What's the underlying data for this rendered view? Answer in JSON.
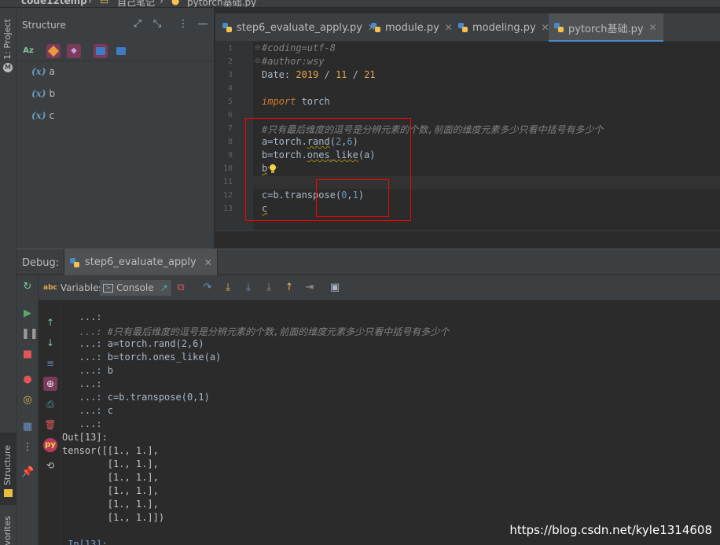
{
  "breadcrumb": {
    "project": "code12temp",
    "folder": "自己笔记",
    "file": "pytorch基础.py"
  },
  "left_strip": {
    "project_label": "1: Project",
    "structure_label": "Z: Structure",
    "favorites_label": "vorites"
  },
  "structure": {
    "title": "Structure",
    "items": [
      {
        "badge": "(x)",
        "name": "a"
      },
      {
        "badge": "(x)",
        "name": "b"
      },
      {
        "badge": "(x)",
        "name": "c"
      }
    ]
  },
  "tabs": [
    {
      "label": "step6_evaluate_apply.py",
      "active": false
    },
    {
      "label": "module.py",
      "active": false
    },
    {
      "label": "modeling.py",
      "active": false
    },
    {
      "label": "pytorch基础.py",
      "active": true
    }
  ],
  "editor": {
    "line_numbers": [
      "1",
      "2",
      "3",
      "4",
      "5",
      "6",
      "7",
      "8",
      "9",
      "10",
      "11",
      "12",
      "13"
    ],
    "lines": {
      "l1": "#coding=utf-8",
      "l2": "#author:wsy",
      "l3_prefix": "Date: ",
      "l3_year": "2019",
      "l3_sep1": " / ",
      "l3_month": "11",
      "l3_sep2": " / ",
      "l3_day": "21",
      "l5_kw": "import",
      "l5_rest": " torch",
      "l7": "#只有最后维度的逗号是分辨元素的个数,前面的维度元素多少只看中括号有多少个",
      "l8_a": "a=torch.",
      "l8_fn": "rand",
      "l8_b": "(",
      "l8_n1": "2",
      "l8_c": ",",
      "l8_n2": "6",
      "l8_d": ")",
      "l9_a": "b=torch.",
      "l9_fn": "ones_like",
      "l9_b": "(a)",
      "l10": "b",
      "l12_a": "c=b.",
      "l12_fn": "transpose",
      "l12_b": "(",
      "l12_n1": "0",
      "l12_c": ",",
      "l12_n2": "1",
      "l12_d": ")",
      "l13": "c"
    }
  },
  "debug": {
    "label": "Debug:",
    "session": "step6_evaluate_apply",
    "tab_variables": "Variables",
    "tab_console": "Console",
    "variables_badge": "abc"
  },
  "console": {
    "lines": [
      "   ...:",
      "   ...: #只有最后维度的逗号是分辨元素的个数,前面的维度元素多少只看中括号有多少个",
      "   ...: a=torch.rand(2,6)",
      "   ...: b=torch.ones_like(a)",
      "   ...: b",
      "   ...:",
      "   ...: c=b.transpose(0,1)",
      "   ...: c",
      "   ...:",
      "Out[13]:",
      "tensor([[1., 1.],",
      "        [1., 1.],",
      "        [1., 1.],",
      "        [1., 1.],",
      "        [1., 1.],",
      "        [1., 1.]])",
      "",
      " In[13]:"
    ]
  },
  "watermark": "https://blog.csdn.net/kyle1314608",
  "colors": {
    "accent": "#4a88c7",
    "highlight_box": "#ff0000",
    "comment": "#629755",
    "number": "#6897bb",
    "keyword": "#cc7832"
  }
}
